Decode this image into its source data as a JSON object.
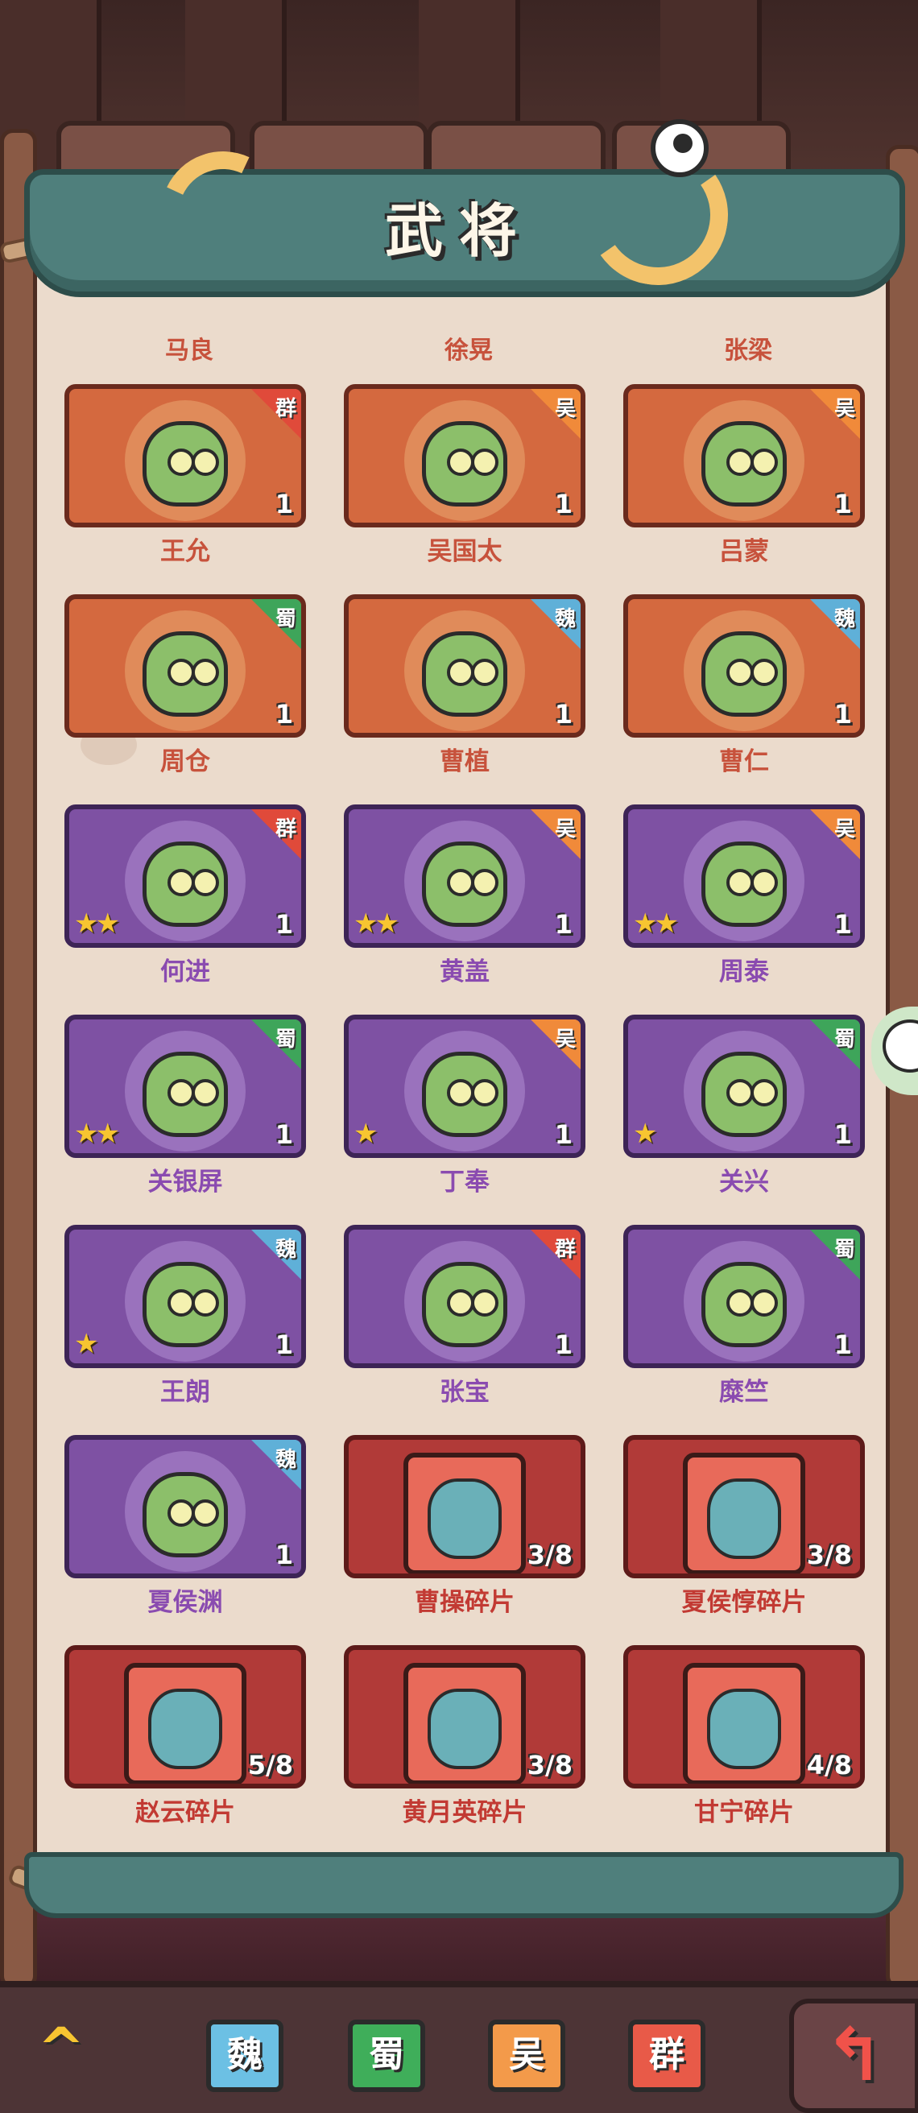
{
  "header": {
    "title": "武将"
  },
  "top_names": [
    "马良",
    "徐晃",
    "张梁"
  ],
  "cards": [
    {
      "name": "王允",
      "faction": "群",
      "faction_class": "qun",
      "count": "1",
      "style": "orange",
      "stars": ""
    },
    {
      "name": "吴国太",
      "faction": "吴",
      "faction_class": "wu",
      "count": "1",
      "style": "orange",
      "stars": ""
    },
    {
      "name": "吕蒙",
      "faction": "吴",
      "faction_class": "wu",
      "count": "1",
      "style": "orange",
      "stars": ""
    },
    {
      "name": "周仓",
      "faction": "蜀",
      "faction_class": "shu",
      "count": "1",
      "style": "orange",
      "stars": ""
    },
    {
      "name": "曹植",
      "faction": "魏",
      "faction_class": "wei",
      "count": "1",
      "style": "orange",
      "stars": ""
    },
    {
      "name": "曹仁",
      "faction": "魏",
      "faction_class": "wei",
      "count": "1",
      "style": "orange",
      "stars": ""
    },
    {
      "name": "何进",
      "faction": "群",
      "faction_class": "qun",
      "count": "1",
      "style": "purple",
      "stars": "★★"
    },
    {
      "name": "黄盖",
      "faction": "吴",
      "faction_class": "wu",
      "count": "1",
      "style": "purple",
      "stars": "★★"
    },
    {
      "name": "周泰",
      "faction": "吴",
      "faction_class": "wu",
      "count": "1",
      "style": "purple",
      "stars": "★★"
    },
    {
      "name": "关银屏",
      "faction": "蜀",
      "faction_class": "shu",
      "count": "1",
      "style": "purple",
      "stars": "★★"
    },
    {
      "name": "丁奉",
      "faction": "吴",
      "faction_class": "wu",
      "count": "1",
      "style": "purple",
      "stars": "★"
    },
    {
      "name": "关兴",
      "faction": "蜀",
      "faction_class": "shu",
      "count": "1",
      "style": "purple",
      "stars": "★"
    },
    {
      "name": "王朗",
      "faction": "魏",
      "faction_class": "wei",
      "count": "1",
      "style": "purple",
      "stars": "★"
    },
    {
      "name": "张宝",
      "faction": "群",
      "faction_class": "qun",
      "count": "1",
      "style": "purple",
      "stars": ""
    },
    {
      "name": "糜竺",
      "faction": "蜀",
      "faction_class": "shu",
      "count": "1",
      "style": "purple",
      "stars": ""
    },
    {
      "name": "夏侯渊",
      "faction": "魏",
      "faction_class": "wei",
      "count": "1",
      "style": "purple",
      "stars": ""
    },
    {
      "name": "曹操碎片",
      "faction": "",
      "faction_class": "",
      "count": "3/8",
      "style": "red",
      "stars": ""
    },
    {
      "name": "夏侯惇碎片",
      "faction": "",
      "faction_class": "",
      "count": "3/8",
      "style": "red",
      "stars": ""
    },
    {
      "name": "赵云碎片",
      "faction": "",
      "faction_class": "",
      "count": "5/8",
      "style": "red",
      "stars": ""
    },
    {
      "name": "黄月英碎片",
      "faction": "",
      "faction_class": "",
      "count": "3/8",
      "style": "red",
      "stars": ""
    },
    {
      "name": "甘宁碎片",
      "faction": "",
      "faction_class": "",
      "count": "4/8",
      "style": "red",
      "stars": ""
    }
  ],
  "bottom_bar": {
    "up_icon": "chevron-up-icon",
    "tabs": [
      "魏",
      "蜀",
      "吴",
      "群"
    ],
    "back_icon": "return-arrow-icon",
    "up_glyph": "^",
    "back_glyph": "↰"
  },
  "colors": {
    "name_orange": "#c7523c",
    "name_purple": "#8a4bb0",
    "name_red": "#c23a33"
  }
}
